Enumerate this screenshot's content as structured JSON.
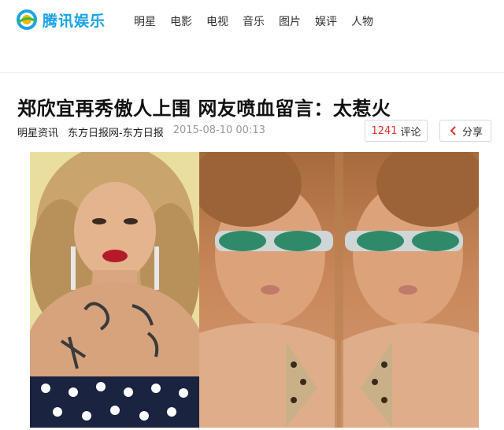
{
  "header": {
    "logo_text": "腾讯娱乐",
    "nav": [
      "明星",
      "电影",
      "电视",
      "音乐",
      "图片",
      "娱评",
      "人物"
    ]
  },
  "article": {
    "title": "郑欣宜再秀傲人上围 网友喷血留言：太惹火",
    "category": "明星资讯",
    "source": "东方日报网-东方日报",
    "timestamp": "2015-08-10 00:13",
    "comments_count": "1241",
    "comments_label": "评论",
    "share_label": "分享"
  },
  "colors": {
    "brand": "#1aa3e8",
    "comment_count": "#e0302d"
  }
}
